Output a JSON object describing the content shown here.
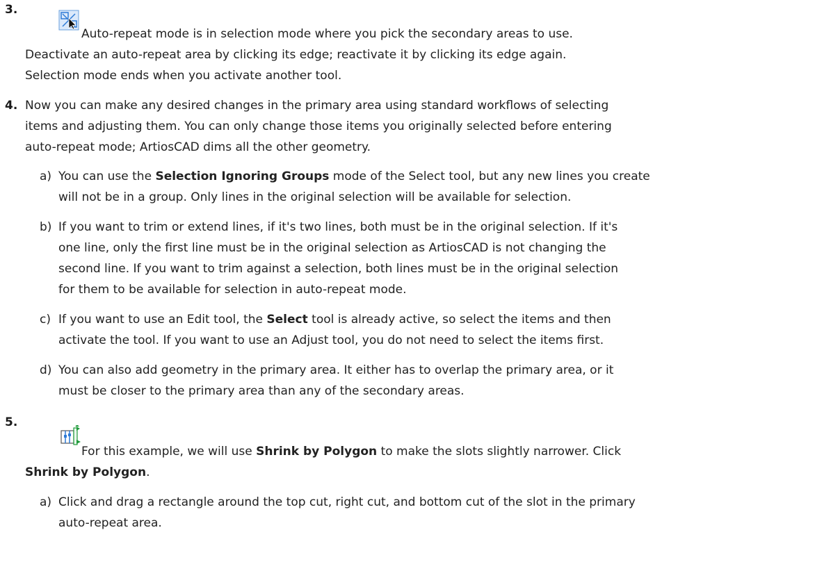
{
  "step3": {
    "number": "3.",
    "icon": "auto-repeat-select-icon",
    "lines": [
      "Auto-repeat mode is in selection mode where you pick the secondary areas to use.",
      "Deactivate an auto-repeat area by clicking its edge; reactivate it by clicking its edge again.",
      "Selection mode ends when you activate another tool."
    ]
  },
  "step4": {
    "number": "4.",
    "lines": [
      "Now you can make any desired changes in the primary area using standard workflows of selecting",
      "items and adjusting them. You can only change those items you originally selected before entering",
      "auto-repeat mode; ArtiosCAD dims all the other geometry."
    ],
    "items": [
      {
        "letter": "a)",
        "line1_pre": "You can use the ",
        "line1_bold": "Selection Ignoring Groups",
        "line1_post": " mode of the Select tool, but any new lines you create",
        "line2": "will not be in a group. Only lines in the original selection will be available for selection."
      },
      {
        "letter": "b)",
        "lines": [
          "If you want to trim or extend lines, if it's two lines, both must be in the original selection. If it's",
          "one line, only the first line must be in the original selection as ArtiosCAD is not changing the",
          "second line. If you want to trim against a selection, both lines must be in the original selection",
          "for them to be available for selection in auto-repeat mode."
        ]
      },
      {
        "letter": "c)",
        "line1_pre": "If you want to use an Edit tool, the ",
        "line1_bold": "Select",
        "line1_post": " tool is already active, so select the items and then",
        "line2": "activate the tool. If you want to use an Adjust tool, you do not need to select the items first."
      },
      {
        "letter": "d)",
        "lines": [
          "You can also add geometry in the primary area. It either has to overlap the primary area, or it",
          "must be closer to the primary area than any of the secondary areas."
        ]
      }
    ]
  },
  "step5": {
    "number": "5.",
    "icon": "shrink-by-polygon-icon",
    "line1_pre": "For this example, we will use ",
    "line1_bold": "Shrink by Polygon",
    "line1_post": " to make the slots slightly narrower. Click",
    "line2_bold": "Shrink by Polygon",
    "line2_post": ".",
    "items": [
      {
        "letter": "a)",
        "lines": [
          "Click and drag a rectangle around the top cut, right cut, and bottom cut of the slot in the primary",
          "auto-repeat area."
        ]
      }
    ]
  },
  "colors": {
    "icon_blue": "#2e7bd6",
    "icon_green": "#1f9a3a"
  }
}
